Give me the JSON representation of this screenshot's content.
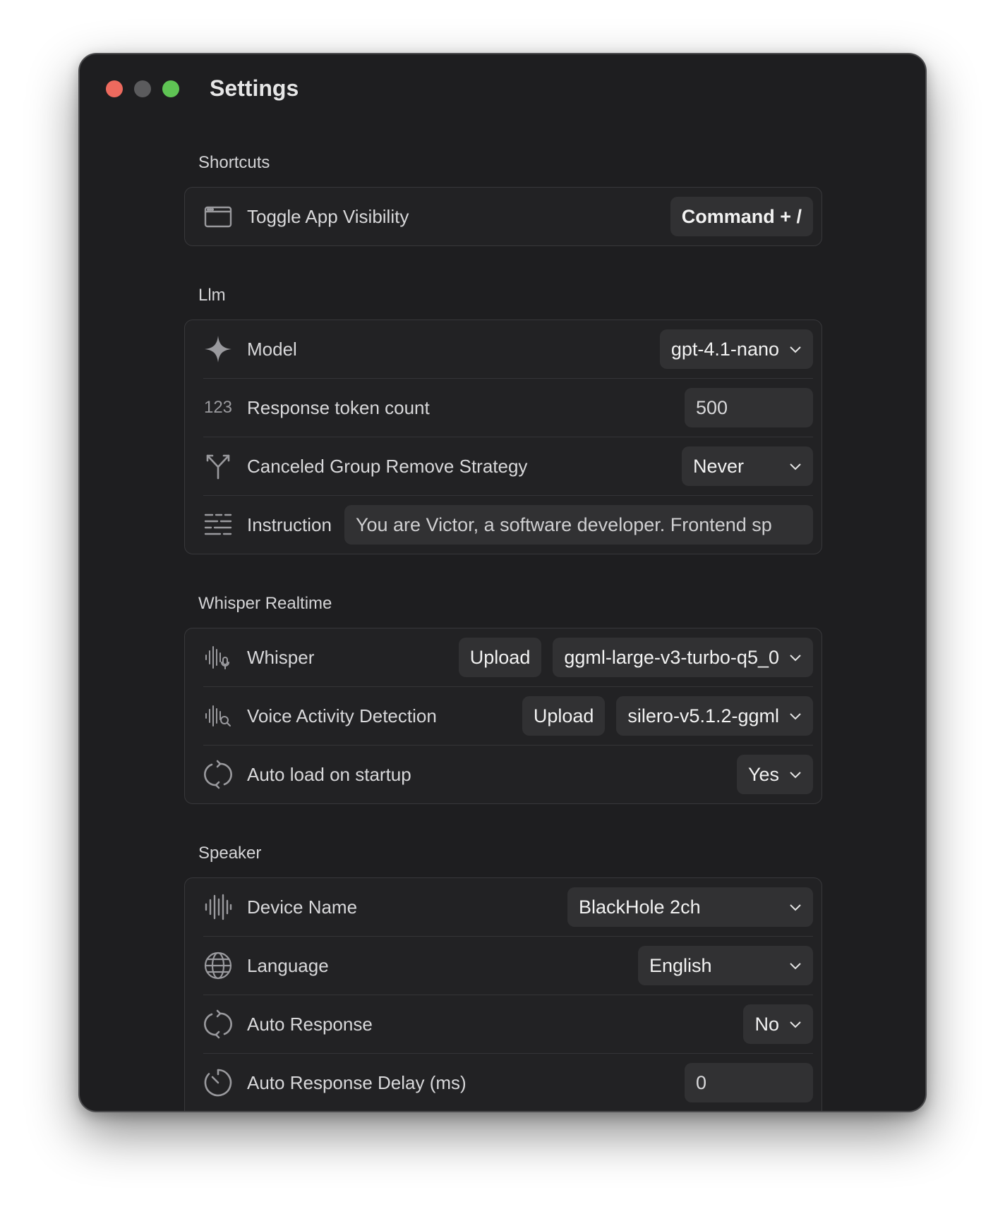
{
  "window": {
    "title": "Settings"
  },
  "sections": {
    "shortcuts": {
      "title": "Shortcuts",
      "toggle_app": {
        "label": "Toggle App Visibility",
        "value": "Command + /"
      }
    },
    "llm": {
      "title": "Llm",
      "model": {
        "label": "Model",
        "value": "gpt-4.1-nano"
      },
      "token_count": {
        "icon_text": "123",
        "label": "Response token count",
        "value": "500"
      },
      "remove_strategy": {
        "label": "Canceled Group Remove Strategy",
        "value": "Never"
      },
      "instruction": {
        "label": "Instruction",
        "value": "You are Victor, a software developer. Frontend sp"
      }
    },
    "whisper": {
      "title": "Whisper Realtime",
      "whisper": {
        "label": "Whisper",
        "upload": "Upload",
        "value": "ggml-large-v3-turbo-q5_0"
      },
      "vad": {
        "label": "Voice Activity Detection",
        "upload": "Upload",
        "value": "silero-v5.1.2-ggml"
      },
      "auto_load": {
        "label": "Auto load on startup",
        "value": "Yes"
      }
    },
    "speaker": {
      "title": "Speaker",
      "device": {
        "label": "Device Name",
        "value": "BlackHole 2ch"
      },
      "language": {
        "label": "Language",
        "value": "English"
      },
      "auto_response": {
        "label": "Auto Response",
        "value": "No"
      },
      "delay": {
        "label": "Auto Response Delay (ms)",
        "value": "0"
      }
    }
  },
  "icons": {
    "window": "window-icon",
    "sparkle": "sparkle-icon",
    "number": "number-icon",
    "branch": "branch-icon",
    "text_lines": "text-lines-icon",
    "waveform_mic": "waveform-mic-icon",
    "waveform_search": "waveform-search-icon",
    "refresh": "refresh-icon",
    "waveform": "waveform-icon",
    "globe": "globe-icon",
    "timer": "timer-icon",
    "chevron": "chevron-down-icon"
  },
  "colors": {
    "window_bg": "#1e1e20",
    "group_bg": "#222224",
    "control_bg": "#313133",
    "close": "#ed6a5e",
    "minimize": "#5b5b5d",
    "maximize": "#5fc454"
  }
}
